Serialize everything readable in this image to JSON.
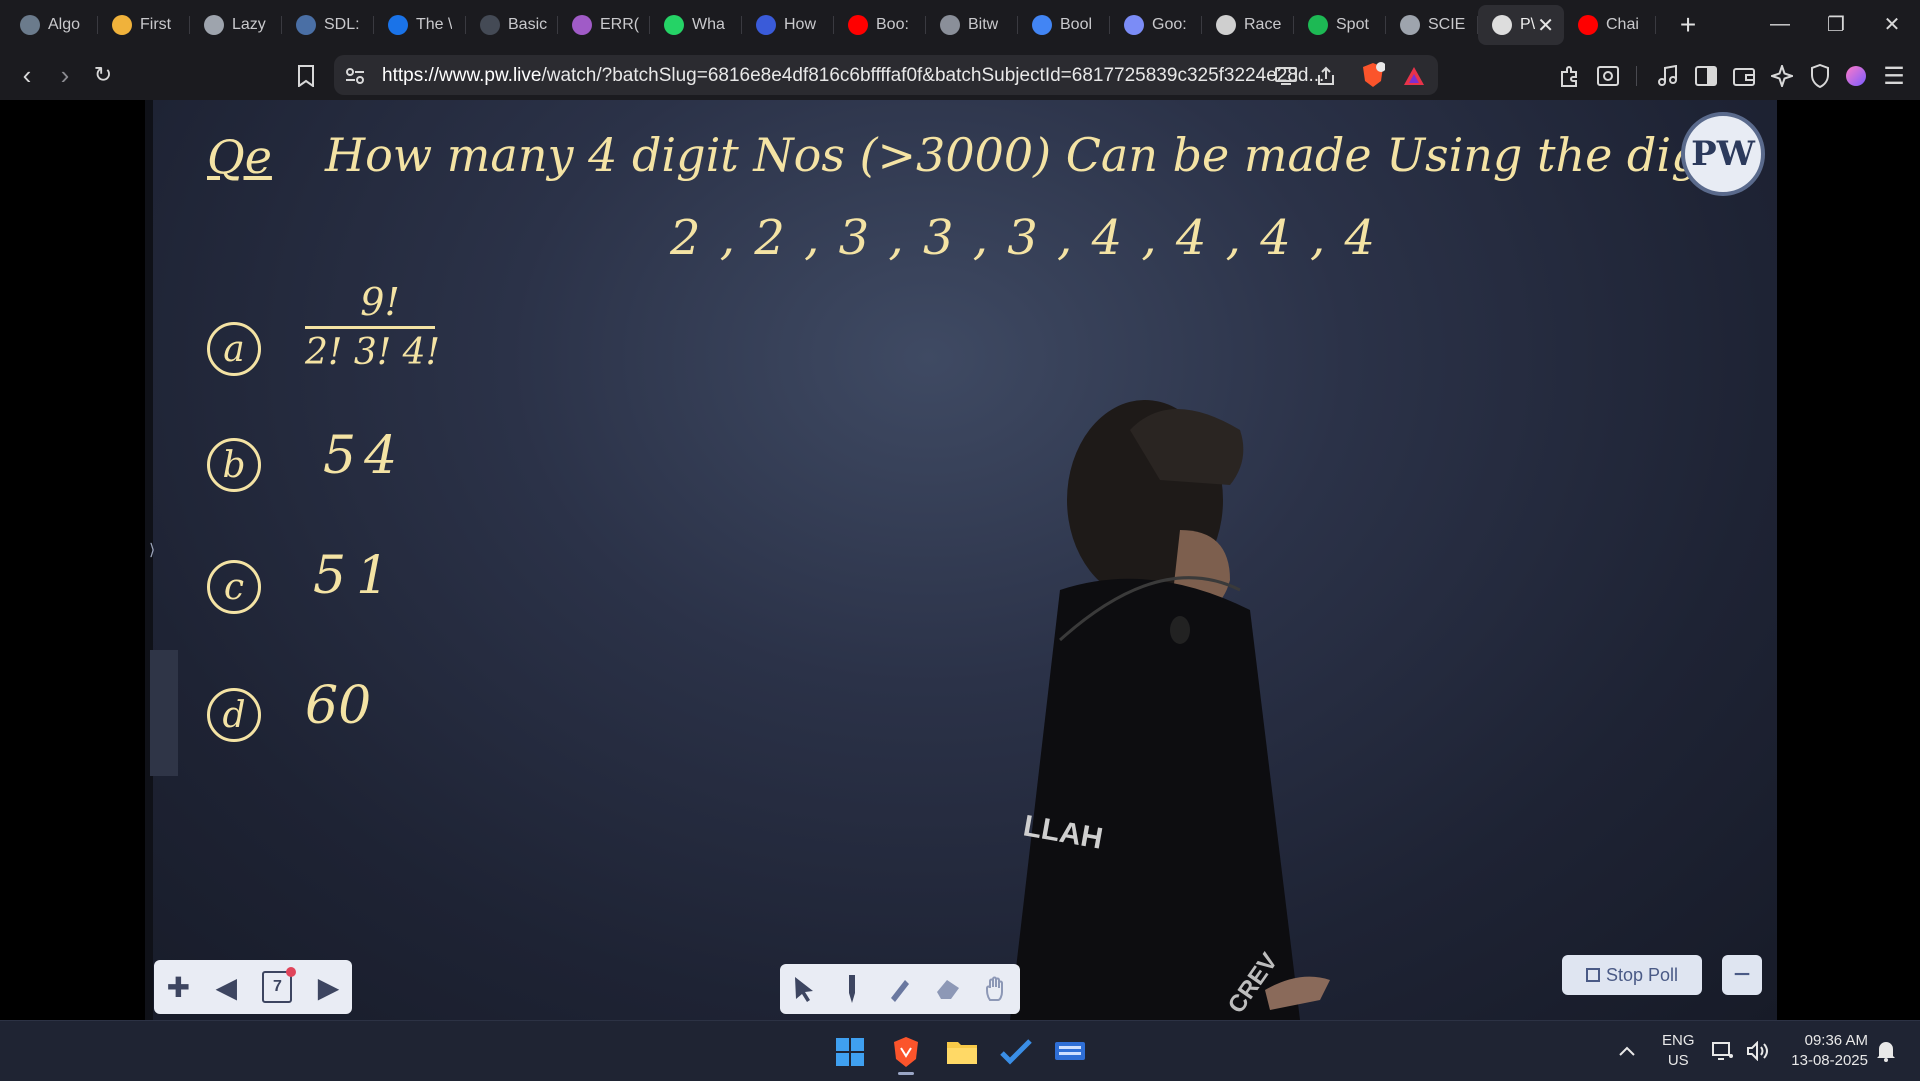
{
  "browser": {
    "tabs": [
      {
        "title": "Algo",
        "icon": "app-icon",
        "color": "#6b7b8c"
      },
      {
        "title": "First",
        "icon": "bolt-icon",
        "color": "#f0b23b"
      },
      {
        "title": "Lazy",
        "icon": "globe-icon",
        "color": "#9ea4ad"
      },
      {
        "title": "SDL:",
        "icon": "doc-icon",
        "color": "#4a6fa5"
      },
      {
        "title": "The \\",
        "icon": "w3-icon",
        "color": "#1a73e8"
      },
      {
        "title": "Basic",
        "icon": "book-icon",
        "color": "#444a55"
      },
      {
        "title": "ERR(",
        "icon": "brain-icon",
        "color": "#a05bc7"
      },
      {
        "title": "Wha",
        "icon": "whatsapp-icon",
        "color": "#25d366"
      },
      {
        "title": "How",
        "icon": "bookmark-icon",
        "color": "#3a5bd9"
      },
      {
        "title": "Boo:",
        "icon": "youtube-icon",
        "color": "#ff0000"
      },
      {
        "title": "Bitw",
        "icon": "orb-icon",
        "color": "#8a8f99"
      },
      {
        "title": "Bool",
        "icon": "google-icon",
        "color": "#4285f4"
      },
      {
        "title": "Goo:",
        "icon": "gemini-icon",
        "color": "#7b8cf6"
      },
      {
        "title": "Race",
        "icon": "openai-icon",
        "color": "#cfcfcf"
      },
      {
        "title": "Spot",
        "icon": "spotify-icon",
        "color": "#1db954"
      },
      {
        "title": "SCIE",
        "icon": "globe-icon",
        "color": "#9ea4ad"
      },
      {
        "title": "P\\",
        "icon": "speaker-icon",
        "color": "#dddddd",
        "active": true
      },
      {
        "title": "Chai",
        "icon": "youtube-icon",
        "color": "#ff0000"
      }
    ],
    "new_tab": "+",
    "url_host": "https://www.pw.live",
    "url_rest": "/watch/?batchSlug=6816e8e4df816c6bffffaf0f&batchSubjectId=6817725839c325f3224e28d..."
  },
  "board": {
    "question_label": "Qe",
    "question_line1": "How many 4 digit Nos (>3000) Can be made Using the digits",
    "question_line2": "2 , 2 , 3 , 3 , 3 , 4 , 4 , 4 , 4",
    "options": [
      {
        "letter": "a",
        "numerator": "9!",
        "denominator": "2! 3! 4!"
      },
      {
        "letter": "b",
        "text": "54"
      },
      {
        "letter": "c",
        "text": "51"
      },
      {
        "letter": "d",
        "text": "60"
      }
    ],
    "logo_text": "PW",
    "shirt_text": "LLAH",
    "shirt_text2": "CREV"
  },
  "player": {
    "page_number": "7",
    "stop_poll_label": "Stop Poll",
    "minimize_label": "−"
  },
  "taskbar": {
    "lang_line1": "ENG",
    "lang_line2": "US",
    "time": "09:36 AM",
    "date": "13-08-2025"
  }
}
